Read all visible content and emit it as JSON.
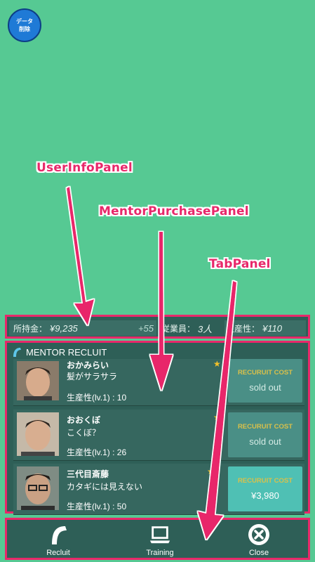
{
  "data_delete_button": {
    "line1": "データ",
    "line2": "削除"
  },
  "annotations": {
    "user_info": "UserInfoPanel",
    "mentor_purchase": "MentorPurchasePanel",
    "tab": "TabPanel"
  },
  "user_info": {
    "money_label": "所持金：",
    "money_value": "¥9,235",
    "money_delta": "+55",
    "employees_label": "従業員：",
    "employees_value": "3人",
    "productivity_label": "生産性：",
    "productivity_value": "¥110"
  },
  "mentor_panel": {
    "title": "MENTOR RECLUIT",
    "mentors": [
      {
        "name": "おかみらい",
        "desc": "髪がサラサラ",
        "productivity": "生産性(lv.1) : 10",
        "star": "★",
        "cost_label": "RECURUIT COST",
        "cost_value": "sold out"
      },
      {
        "name": "おおくぼ",
        "desc": "こくぼ？",
        "productivity": "生産性(lv.1) : 26",
        "star": "★",
        "cost_label": "RECURUIT COST",
        "cost_value": "sold out"
      },
      {
        "name": "三代目斎藤",
        "desc": "カタギには見えない",
        "productivity": "生産性(lv.1) : 50",
        "star": "★",
        "cost_label": "RECURUIT COST",
        "cost_value": "¥3,980"
      }
    ]
  },
  "tabs": [
    {
      "label": "Recluit",
      "icon": "recruit-logo-icon"
    },
    {
      "label": "Training",
      "icon": "laptop-icon"
    },
    {
      "label": "Close",
      "icon": "close-circle-icon"
    }
  ],
  "colors": {
    "background": "#56c993",
    "panel": "#2e5f57",
    "annotation": "#e8286a",
    "cost_label": "#d9c04a",
    "active_cost": "#4fc0b4"
  }
}
